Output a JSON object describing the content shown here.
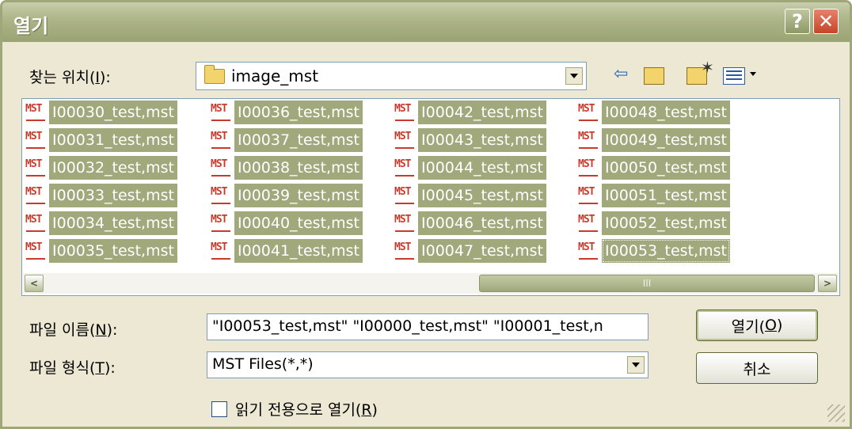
{
  "window": {
    "title": "열기"
  },
  "titlebar": {
    "help_label": "?",
    "close_label": "✕"
  },
  "lookin": {
    "label_pre": "찾는 위치(",
    "label_key": "I",
    "label_post": "):",
    "value": "image_mst"
  },
  "toolbar": {
    "icons": [
      "back-icon",
      "up-folder-icon",
      "new-folder-icon",
      "view-menu-icon"
    ]
  },
  "file_list": {
    "icon_text": "MST",
    "columns": [
      [
        "I00030_test,mst",
        "I00031_test,mst",
        "I00032_test,mst",
        "I00033_test,mst",
        "I00034_test,mst",
        "I00035_test,mst"
      ],
      [
        "I00036_test,mst",
        "I00037_test,mst",
        "I00038_test,mst",
        "I00039_test,mst",
        "I00040_test,mst",
        "I00041_test,mst"
      ],
      [
        "I00042_test,mst",
        "I00043_test,mst",
        "I00044_test,mst",
        "I00045_test,mst",
        "I00046_test,mst",
        "I00047_test,mst"
      ],
      [
        "I00048_test,mst",
        "I00049_test,mst",
        "I00050_test,mst",
        "I00051_test,mst",
        "I00052_test,mst",
        "I00053_test,mst"
      ]
    ],
    "scroll_thumb_label": "III"
  },
  "filename": {
    "label_pre": "파일 이름(",
    "label_key": "N",
    "label_post": "):",
    "value": "\"I00053_test,mst\" \"I00000_test,mst\" \"I00001_test,n"
  },
  "filetype": {
    "label_pre": "파일 형식(",
    "label_key": "T",
    "label_post": "):",
    "value": "MST Files(*,*)"
  },
  "readonly": {
    "label_pre": "읽기 전용으로 열기(",
    "label_key": "R",
    "label_post": ")",
    "checked": false
  },
  "buttons": {
    "open_pre": "열기(",
    "open_key": "O",
    "open_post": ")",
    "cancel": "취소"
  },
  "colors": {
    "titlebar": "#a5ad80",
    "selection": "#a0a87c",
    "dialog_bg": "#ece8d3",
    "close_button": "#d4553a"
  }
}
